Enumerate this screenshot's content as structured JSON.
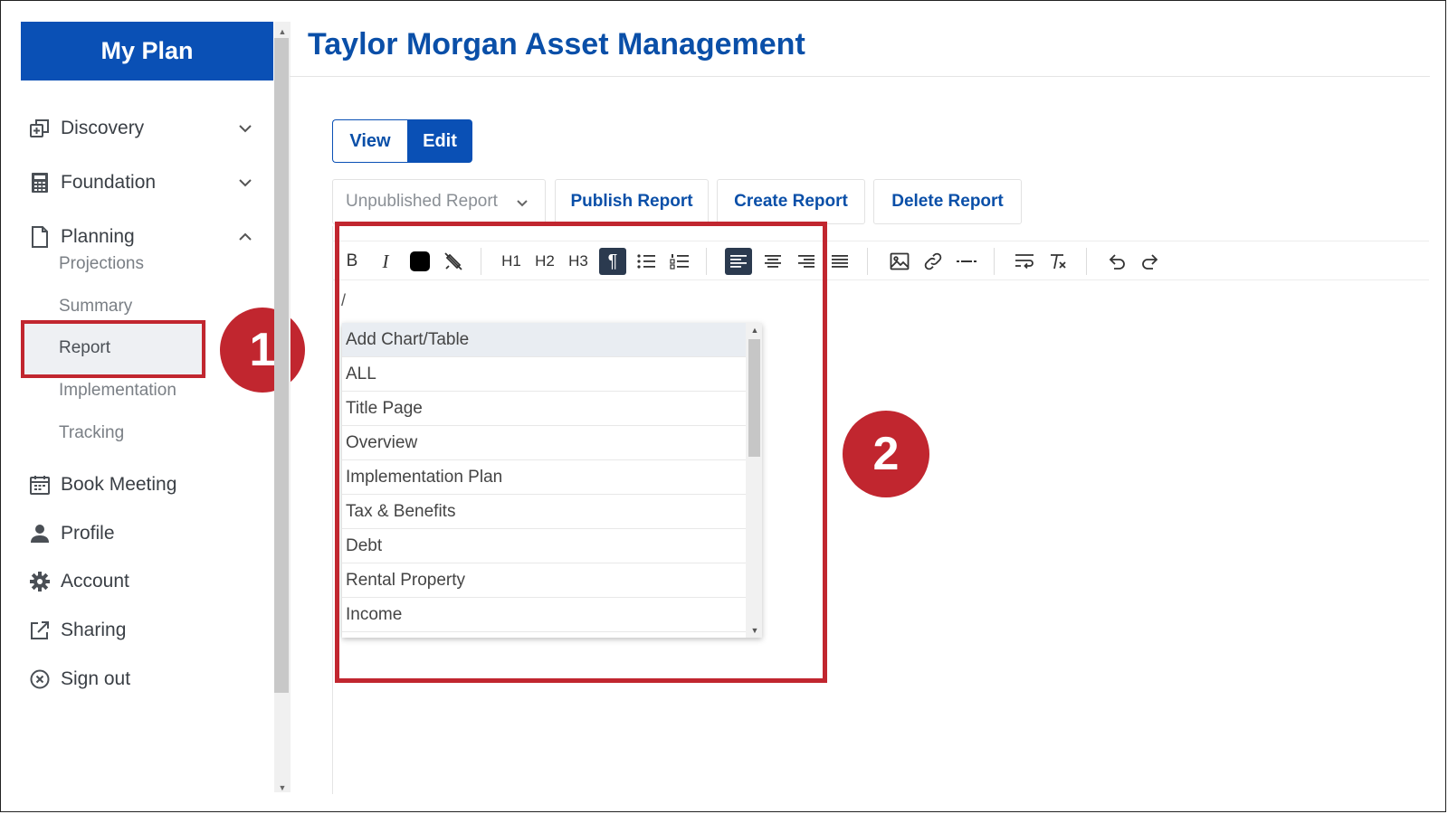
{
  "sidebar": {
    "brand": "My Plan",
    "items": [
      {
        "label": "Discovery",
        "icon": "discovery-icon"
      },
      {
        "label": "Foundation",
        "icon": "calculator-icon"
      },
      {
        "label": "Planning",
        "icon": "document-icon"
      }
    ],
    "planning_sub": [
      "Projections",
      "Summary",
      "Report",
      "Implementation",
      "Tracking"
    ],
    "bottom_items": [
      {
        "label": "Book Meeting",
        "icon": "calendar-icon"
      },
      {
        "label": "Profile",
        "icon": "user-icon"
      },
      {
        "label": "Account",
        "icon": "gear-icon"
      },
      {
        "label": "Sharing",
        "icon": "share-icon"
      },
      {
        "label": "Sign out",
        "icon": "close-circle-icon"
      }
    ],
    "selected": "Report"
  },
  "header": {
    "title": "Taylor Morgan Asset Management"
  },
  "mode": {
    "view": "View",
    "edit": "Edit",
    "active": "Edit"
  },
  "actions": {
    "status_select": "Unpublished Report",
    "publish": "Publish Report",
    "create": "Create Report",
    "delete": "Delete Report"
  },
  "toolbar": {
    "bold": "B",
    "italic": "I",
    "h1": "H1",
    "h2": "H2",
    "h3": "H3",
    "paragraph": "¶"
  },
  "editor": {
    "text": "/",
    "dropdown": [
      "Add Chart/Table",
      "ALL",
      "Title Page",
      "Overview",
      "Implementation Plan",
      "Tax & Benefits",
      "Debt",
      "Rental Property",
      "Income"
    ]
  },
  "callouts": {
    "one": "1",
    "two": "2"
  },
  "colors": {
    "primary": "#0a50b5",
    "callout": "#c1262f",
    "toolbar_active": "#2b3a4f"
  }
}
